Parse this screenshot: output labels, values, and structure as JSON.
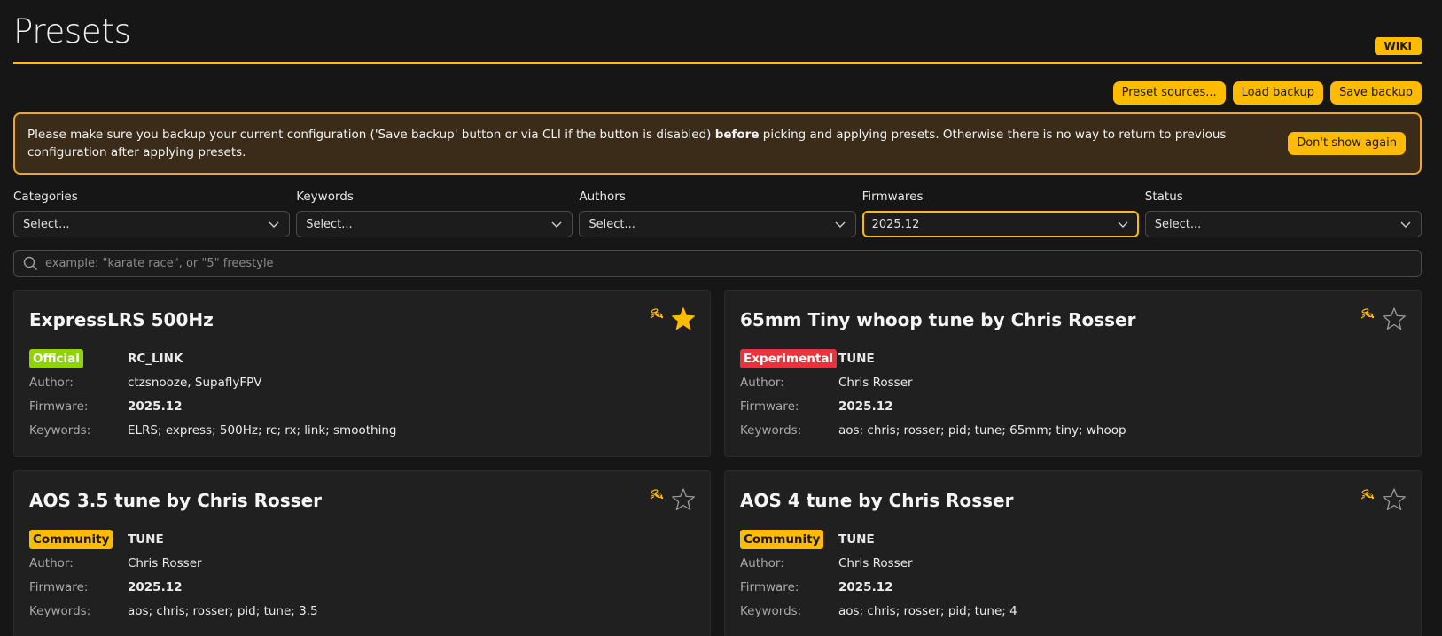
{
  "page": {
    "title": "Presets",
    "wiki_label": "WIKI"
  },
  "toolbar": {
    "preset_sources": "Preset sources...",
    "load_backup": "Load backup",
    "save_backup": "Save backup"
  },
  "warning": {
    "text_before": "Please make sure you backup your current configuration ('Save backup' button or via CLI if the button is disabled) ",
    "text_bold": "before",
    "text_after": " picking and applying presets. Otherwise there is no way to return to previous configuration after applying presets.",
    "dismiss_label": "Don't show again"
  },
  "filters": [
    {
      "label": "Categories",
      "value": "Select..."
    },
    {
      "label": "Keywords",
      "value": "Select..."
    },
    {
      "label": "Authors",
      "value": "Select..."
    },
    {
      "label": "Firmwares",
      "value": "2025.12"
    },
    {
      "label": "Status",
      "value": "Select..."
    }
  ],
  "search": {
    "placeholder": "example: \"karate race\", or \"5\" freestyle",
    "value": ""
  },
  "meta_labels": {
    "author": "Author:",
    "firmware": "Firmware:",
    "keywords": "Keywords:"
  },
  "colors": {
    "accent": "#ffbb00",
    "official": "#8fd400",
    "experimental": "#e8323c",
    "community": "#ffbb00"
  },
  "presets": [
    {
      "title": "ExpressLRS 500Hz",
      "status": "Official",
      "category": "RC_LINK",
      "author": "ctzsnooze, SupaflyFPV",
      "firmware": "2025.12",
      "keywords": "ELRS; express; 500Hz; rc; rx; link; smoothing",
      "favorite": true,
      "icon": "bee-icon"
    },
    {
      "title": "65mm Tiny whoop tune by Chris Rosser",
      "status": "Experimental",
      "category": "TUNE",
      "author": "Chris Rosser",
      "firmware": "2025.12",
      "keywords": "aos; chris; rosser; pid; tune; 65mm; tiny; whoop",
      "favorite": false,
      "icon": "bee-icon"
    },
    {
      "title": "AOS 3.5 tune by Chris Rosser",
      "status": "Community",
      "category": "TUNE",
      "author": "Chris Rosser",
      "firmware": "2025.12",
      "keywords": "aos; chris; rosser; pid; tune; 3.5",
      "favorite": false,
      "icon": "bee-icon"
    },
    {
      "title": "AOS 4 tune by Chris Rosser",
      "status": "Community",
      "category": "TUNE",
      "author": "Chris Rosser",
      "firmware": "2025.12",
      "keywords": "aos; chris; rosser; pid; tune; 4",
      "favorite": false,
      "icon": "bee-icon"
    }
  ]
}
